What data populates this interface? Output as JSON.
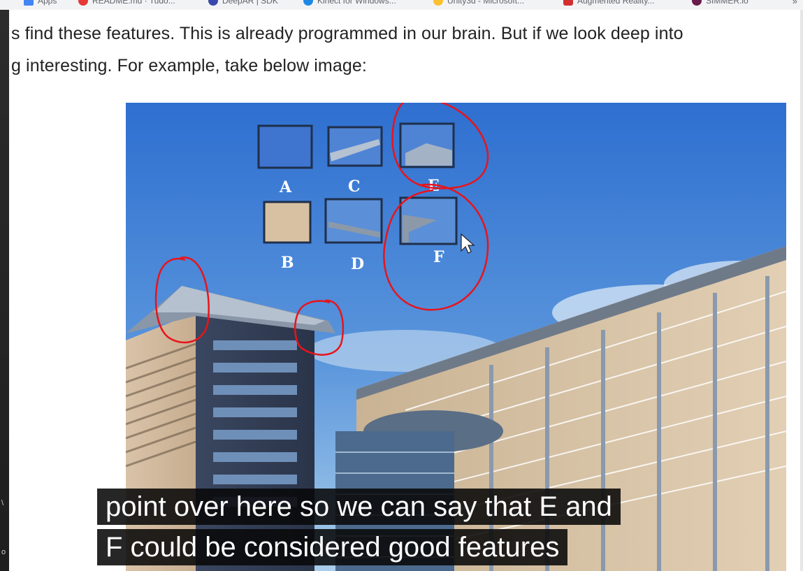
{
  "bookmarks_bar": {
    "items": [
      {
        "label": "Apps",
        "color": "#4285f4"
      },
      {
        "label": "README.md · Tudo...",
        "color": "#e53935"
      },
      {
        "label": "DeepAR | SDK",
        "color": "#3949ab"
      },
      {
        "label": "Kinect for Windows...",
        "color": "#1e88e5"
      },
      {
        "label": "Unity3d - Microsoft...",
        "color": "#fbc02d"
      },
      {
        "label": "Augmented Reality...",
        "color": "#d32f2f"
      },
      {
        "label": "SIMMER.io",
        "color": "#6a1b4d"
      }
    ],
    "more": "»"
  },
  "article": {
    "line1": "s find these features. This is already programmed in our brain. But if we look deep into",
    "line2": "g interesting. For example, take below image:"
  },
  "figure": {
    "patch_labels": [
      "A",
      "C",
      "E",
      "B",
      "D",
      "F"
    ],
    "annotation_color": "#e8141b",
    "sky_top": "#2e6fd0",
    "sky_bottom": "#a9cdea"
  },
  "subtitles": {
    "line1": "point over here so we can say that E and",
    "line2": "F could be considered good features"
  },
  "left_strip": {
    "mark1": "\\",
    "mark2": "o"
  }
}
